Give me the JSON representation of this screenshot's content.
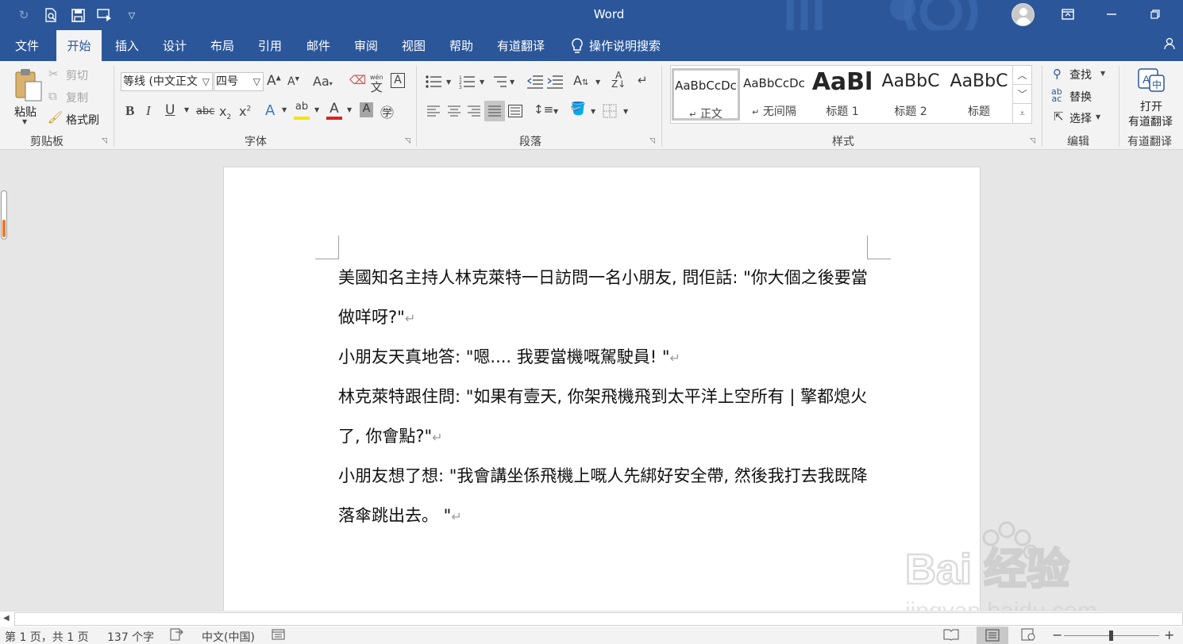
{
  "app": {
    "title": "Word"
  },
  "tabs": [
    "文件",
    "开始",
    "插入",
    "设计",
    "布局",
    "引用",
    "邮件",
    "审阅",
    "视图",
    "帮助",
    "有道翻译"
  ],
  "active_tab": "开始",
  "tell_me": "操作说明搜索",
  "clipboard": {
    "paste": "粘贴",
    "cut": "剪切",
    "copy": "复制",
    "format_painter": "格式刷",
    "group_label": "剪贴板"
  },
  "font": {
    "font_name": "等线 (中文正文",
    "font_size": "四号",
    "group_label": "字体",
    "wen": "文",
    "wen_ruby": "wén"
  },
  "paragraph": {
    "group_label": "段落"
  },
  "styles": {
    "items": [
      {
        "preview": "AaBbCcDc",
        "name": "正文",
        "mark": "↵"
      },
      {
        "preview": "AaBbCcDc",
        "name": "无间隔",
        "mark": "↵"
      },
      {
        "preview": "AaBl",
        "name": "标题 1",
        "mark": ""
      },
      {
        "preview": "AaBbC",
        "name": "标题 2",
        "mark": ""
      },
      {
        "preview": "AaBbC",
        "name": "标题",
        "mark": ""
      }
    ],
    "group_label": "样式"
  },
  "editing": {
    "find": "查找",
    "replace": "替换",
    "select": "选择",
    "group_label": "编辑"
  },
  "youdao": {
    "open_line1": "打开",
    "open_line2": "有道翻译",
    "group_label": "有道翻译"
  },
  "document": {
    "paragraphs": [
      "美國知名主持人林克萊特一日訪問一名小朋友, 問佢話: \"你大個之後要當做咩呀?\"",
      "小朋友天真地答: \"嗯.... 我要當機嘅駕駛員! \"",
      "林克萊特跟住問: \"如果有壹天, 你架飛機飛到太平洋上空所有 | 擎都熄火了, 你會點?\"",
      "小朋友想了想: \"我會講坐係飛機上嘅人先綁好安全帶, 然後我打去我既降落傘跳出去。 \""
    ],
    "paragraph_mark": "↵"
  },
  "status": {
    "page": "第 1 页，共 1 页",
    "words": "137 个字",
    "language": "中文(中国)"
  },
  "watermark": {
    "text": "Bai 经验",
    "url": "jingyan.baidu.com"
  }
}
